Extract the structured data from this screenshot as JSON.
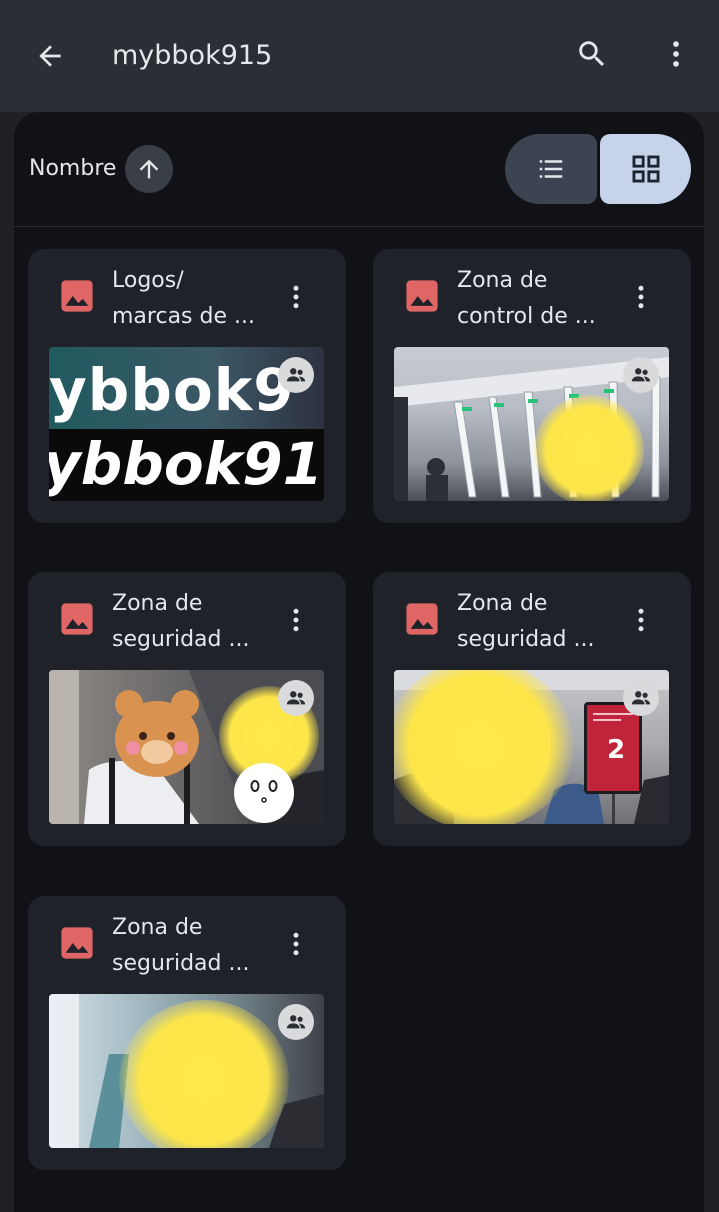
{
  "header": {
    "title": "mybbok915",
    "back_icon": "arrow-back-icon",
    "search_icon": "search-icon",
    "more_icon": "more-vert-icon"
  },
  "sort": {
    "label": "Nombre",
    "direction_icon": "arrow-upward-icon"
  },
  "view_toggle": {
    "list_icon": "list-view-icon",
    "grid_icon": "grid-view-icon",
    "selected": "grid"
  },
  "colors": {
    "header_bg": "#2b2e34",
    "panel_bg": "#101216",
    "card_bg": "#1f2229",
    "image_icon": "#e06666",
    "grid_selected": "#c6d3ea"
  },
  "files": [
    {
      "name_line1": "Logos/",
      "name_line2": "marcas de ...",
      "type_icon": "image-file-icon",
      "shared": true
    },
    {
      "name_line1": "Zona de",
      "name_line2": "control de ...",
      "type_icon": "image-file-icon",
      "shared": true
    },
    {
      "name_line1": "Zona de",
      "name_line2": "seguridad ...",
      "type_icon": "image-file-icon",
      "shared": true
    },
    {
      "name_line1": "Zona de",
      "name_line2": "seguridad ...",
      "type_icon": "image-file-icon",
      "shared": true
    },
    {
      "name_line1": "Zona de",
      "name_line2": "seguridad ...",
      "type_icon": "image-file-icon",
      "shared": true
    }
  ],
  "thumb_text": {
    "logo_top": "ybbok9",
    "logo_bottom": "ybbok91",
    "sign_number": "2"
  }
}
